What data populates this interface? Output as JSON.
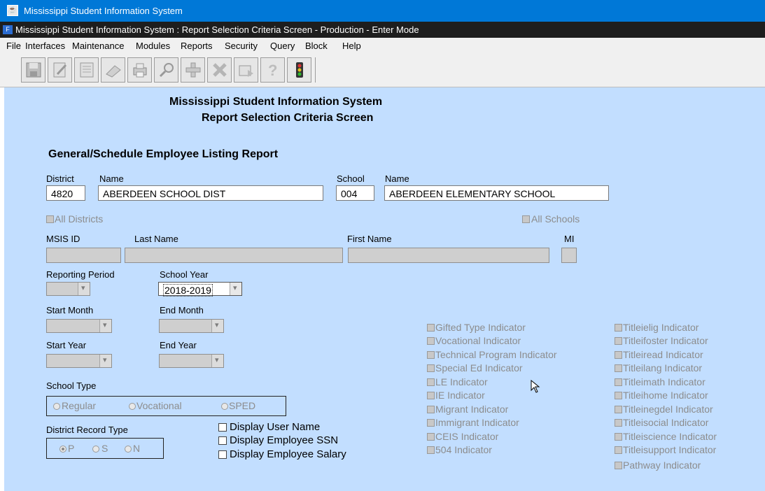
{
  "window": {
    "title": "Mississippi Student Information System"
  },
  "subwindow": {
    "title": "Mississippi Student Information System : Report Selection Criteria Screen  -  Production  -  Enter Mode"
  },
  "menu": [
    "File",
    "Interfaces",
    "Maintenance",
    "Modules",
    "Reports",
    "Security",
    "Query",
    "Block",
    "Help"
  ],
  "toolbar": [
    "save-icon",
    "edit-icon",
    "list-icon",
    "eraser-icon",
    "print-icon",
    "search-icon",
    "add-icon",
    "delete-icon",
    "next-icon",
    "help-icon",
    "traffic-light-icon"
  ],
  "header": {
    "line1": "Mississippi Student Information System",
    "line2": "Report Selection Criteria Screen"
  },
  "report_title": "General/Schedule Employee Listing Report",
  "district": {
    "label": "District",
    "name_label": "Name",
    "code": "4820",
    "name": "ABERDEEN SCHOOL DIST",
    "all_label": "All Districts"
  },
  "school": {
    "label": "School",
    "name_label": "Name",
    "code": "004",
    "name": "ABERDEEN ELEMENTARY SCHOOL",
    "all_label": "All Schools"
  },
  "person": {
    "msis_label": "MSIS ID",
    "last_label": "Last Name",
    "first_label": "First Name",
    "mi_label": "MI"
  },
  "period": {
    "reporting_label": "Reporting Period",
    "year_label": "School Year",
    "year_value": "2018-2019"
  },
  "months": {
    "start_label": "Start Month",
    "end_label": "End Month"
  },
  "years": {
    "start_label": "Start Year",
    "end_label": "End Year"
  },
  "school_type": {
    "label": "School Type",
    "options": [
      "Regular",
      "Vocational",
      "SPED"
    ]
  },
  "district_record": {
    "label": "District Record Type",
    "options": [
      "P",
      "S",
      "N"
    ],
    "selected": "P"
  },
  "display_options": [
    "Display User Name",
    "Display Employee SSN",
    "Display Employee Salary"
  ],
  "indicators_col1": [
    "Gifted Type Indicator",
    "Vocational Indicator",
    "Technical Program Indicator",
    "Special Ed Indicator",
    "LE Indicator",
    "IE Indicator",
    "Migrant Indicator",
    "Immigrant Indicator",
    "CEIS Indicator",
    "504 Indicator"
  ],
  "indicators_col2": [
    "Titleielig Indicator",
    "Titleifoster Indicator",
    "Titleiread Indicator",
    "Titleilang Indicator",
    "Titleimath Indicator",
    "Titleihome Indicator",
    "Titleinegdel Indicator",
    "Titleisocial Indicator",
    "Titleiscience Indicator",
    "Titleisupport Indicator",
    "Pathway Indicator"
  ]
}
